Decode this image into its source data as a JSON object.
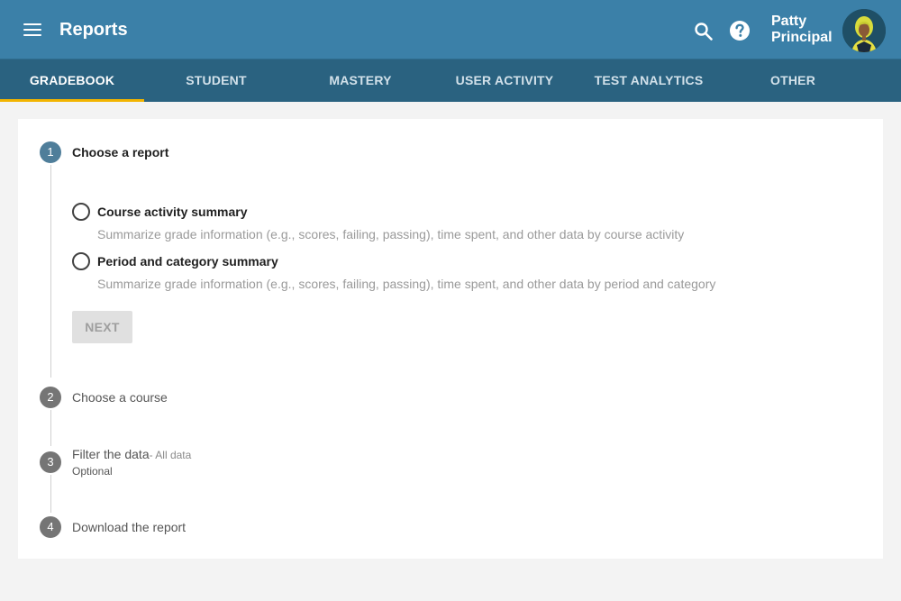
{
  "header": {
    "title": "Reports",
    "user": {
      "first_name": "Patty",
      "last_name": "Principal"
    },
    "icons": {
      "menu": "hamburger-menu-icon",
      "search": "search-icon",
      "help": "help-circle-icon"
    }
  },
  "tabs": [
    {
      "label": "GRADEBOOK",
      "active": true
    },
    {
      "label": "STUDENT",
      "active": false
    },
    {
      "label": "MASTERY",
      "active": false
    },
    {
      "label": "USER ACTIVITY",
      "active": false
    },
    {
      "label": "TEST ANALYTICS",
      "active": false
    },
    {
      "label": "OTHER",
      "active": false
    }
  ],
  "steps": [
    {
      "number": "1",
      "title": "Choose a report",
      "active": true,
      "options": [
        {
          "label": "Course activity summary",
          "description": "Summarize grade information (e.g., scores, failing, passing), time spent, and other data by course activity",
          "selected": false
        },
        {
          "label": "Period and category summary",
          "description": "Summarize grade information (e.g., scores, failing, passing), time spent, and other data by period and category",
          "selected": false
        }
      ],
      "next_label": "NEXT"
    },
    {
      "number": "2",
      "title": "Choose a course",
      "active": false
    },
    {
      "number": "3",
      "title": "Filter the data",
      "extra": "- All data",
      "subtitle": "Optional",
      "active": false
    },
    {
      "number": "4",
      "title": "Download the report",
      "active": false
    }
  ],
  "colors": {
    "appbar": "#3b80a8",
    "tabbar": "#2a6280",
    "tab_indicator": "#f2b400",
    "active_step": "#4f7e9a",
    "inactive_step": "#757575"
  }
}
